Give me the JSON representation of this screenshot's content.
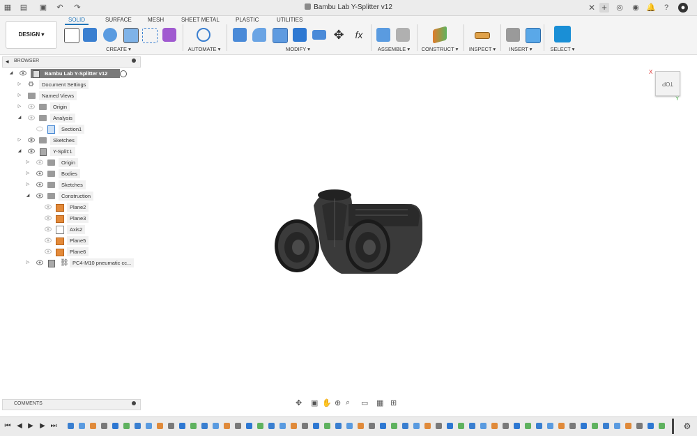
{
  "app": {
    "title": "Bambu Lab Y-Splitter v12"
  },
  "ribbon": {
    "workspace": "DESIGN ▾",
    "tabs": [
      "SOLID",
      "SURFACE",
      "MESH",
      "SHEET METAL",
      "PLASTIC",
      "UTILITIES"
    ],
    "groups": [
      "CREATE ▾",
      "AUTOMATE ▾",
      "MODIFY ▾",
      "ASSEMBLE ▾",
      "CONSTRUCT ▾",
      "INSPECT ▾",
      "INSERT ▾",
      "SELECT ▾"
    ]
  },
  "browser": {
    "label": "BROWSER",
    "root": "Bambu Lab Y-Splitter v12",
    "items": [
      {
        "label": "Document Settings"
      },
      {
        "label": "Named Views"
      },
      {
        "label": "Origin"
      },
      {
        "label": "Analysis"
      },
      {
        "label": "Section1"
      },
      {
        "label": "Sketches"
      },
      {
        "label": "Y-Split:1"
      },
      {
        "label": "Origin"
      },
      {
        "label": "Bodies"
      },
      {
        "label": "Sketches"
      },
      {
        "label": "Construction"
      },
      {
        "label": "Plane2"
      },
      {
        "label": "Plane3"
      },
      {
        "label": "Axis2"
      },
      {
        "label": "Plane5"
      },
      {
        "label": "Plane6"
      },
      {
        "label": "PC4-M10 pneumatic cc..."
      }
    ]
  },
  "comments": {
    "label": "COMMENTS"
  },
  "viewcube": {
    "face": "TOP",
    "axis_x": "X",
    "axis_y": "Y"
  },
  "colors": {
    "accent": "#1f74b8",
    "select_button": "#1a8fd6"
  }
}
